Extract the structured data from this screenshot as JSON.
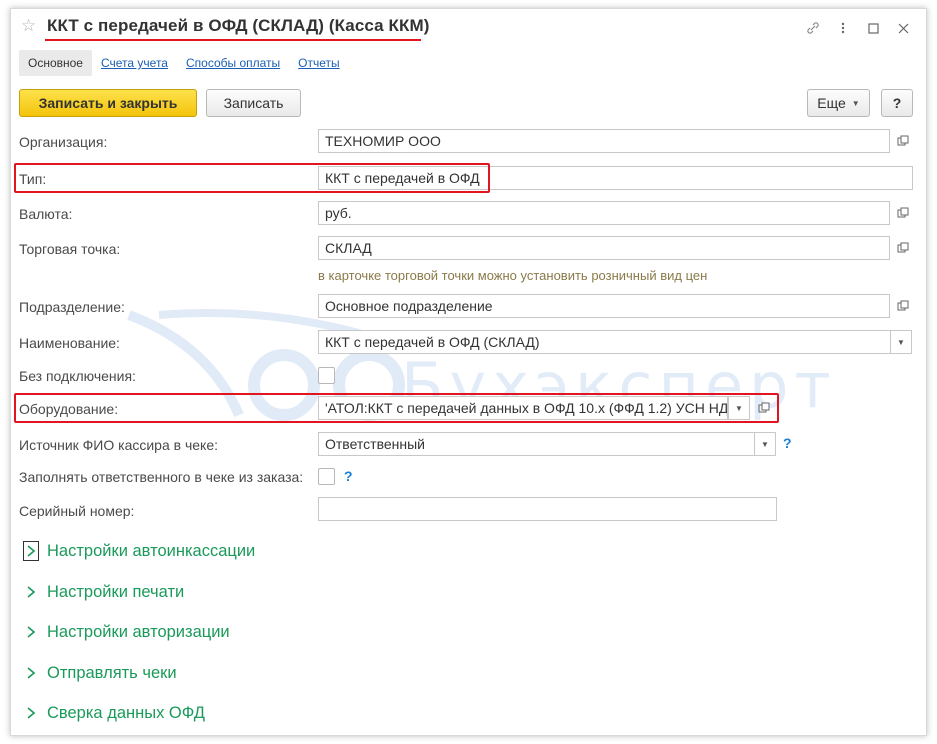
{
  "window": {
    "title": "ККТ с передачей в ОФД (СКЛАД) (Касса ККМ)",
    "title_underline_color": "#e0151f"
  },
  "title_icons": [
    "star-icon",
    "link-icon",
    "more-vert-icon",
    "maximize-icon",
    "close-icon"
  ],
  "tabs": [
    {
      "label": "Основное",
      "active": true
    },
    {
      "label": "Счета учета",
      "active": false
    },
    {
      "label": "Способы оплаты",
      "active": false
    },
    {
      "label": "Отчеты",
      "active": false
    }
  ],
  "toolbar": {
    "save_close_label": "Записать и закрыть",
    "save_label": "Записать",
    "more_label": "Еще",
    "help_label": "?"
  },
  "form": {
    "organization": {
      "label": "Организация:",
      "value": "ТЕХНОМИР ООО"
    },
    "type": {
      "label": "Тип:",
      "value": "ККТ с передачей в ОФД"
    },
    "currency": {
      "label": "Валюта:",
      "value": "руб."
    },
    "trade_point": {
      "label": "Торговая точка:",
      "value": "СКЛАД",
      "hint": "в карточке торговой точки можно установить розничный вид цен"
    },
    "department": {
      "label": "Подразделение:",
      "value": "Основное подразделение"
    },
    "name": {
      "label": "Наименование:",
      "value": "ККТ с передачей в ОФД (СКЛАД)"
    },
    "offline": {
      "label": "Без подключения:",
      "checked": false
    },
    "equipment": {
      "label": "Оборудование:",
      "value": "'АТОЛ:ККТ с передачей данных в ОФД 10.x (ФФД 1.2) УСН НД"
    },
    "cashier_source": {
      "label": "Источник ФИО кассира в чеке:",
      "value": "Ответственный",
      "help": "?"
    },
    "fill_responsible": {
      "label": "Заполнять ответственного в чеке из заказа:",
      "checked": false,
      "help": "?"
    },
    "serial": {
      "label": "Серийный номер:",
      "value": ""
    }
  },
  "sections": [
    {
      "label": "Настройки автоинкассации"
    },
    {
      "label": "Настройки печати"
    },
    {
      "label": "Настройки авторизации"
    },
    {
      "label": "Отправлять чеки"
    },
    {
      "label": "Сверка данных ОФД"
    }
  ],
  "watermark": {
    "text": "Бухэксперт"
  },
  "colors": {
    "accent_red": "#e0151f",
    "primary_button": "#f4c30c",
    "section_green": "#1a9a5a",
    "link_blue": "#1a5fb4",
    "hint_text": "#8a7a4a"
  }
}
